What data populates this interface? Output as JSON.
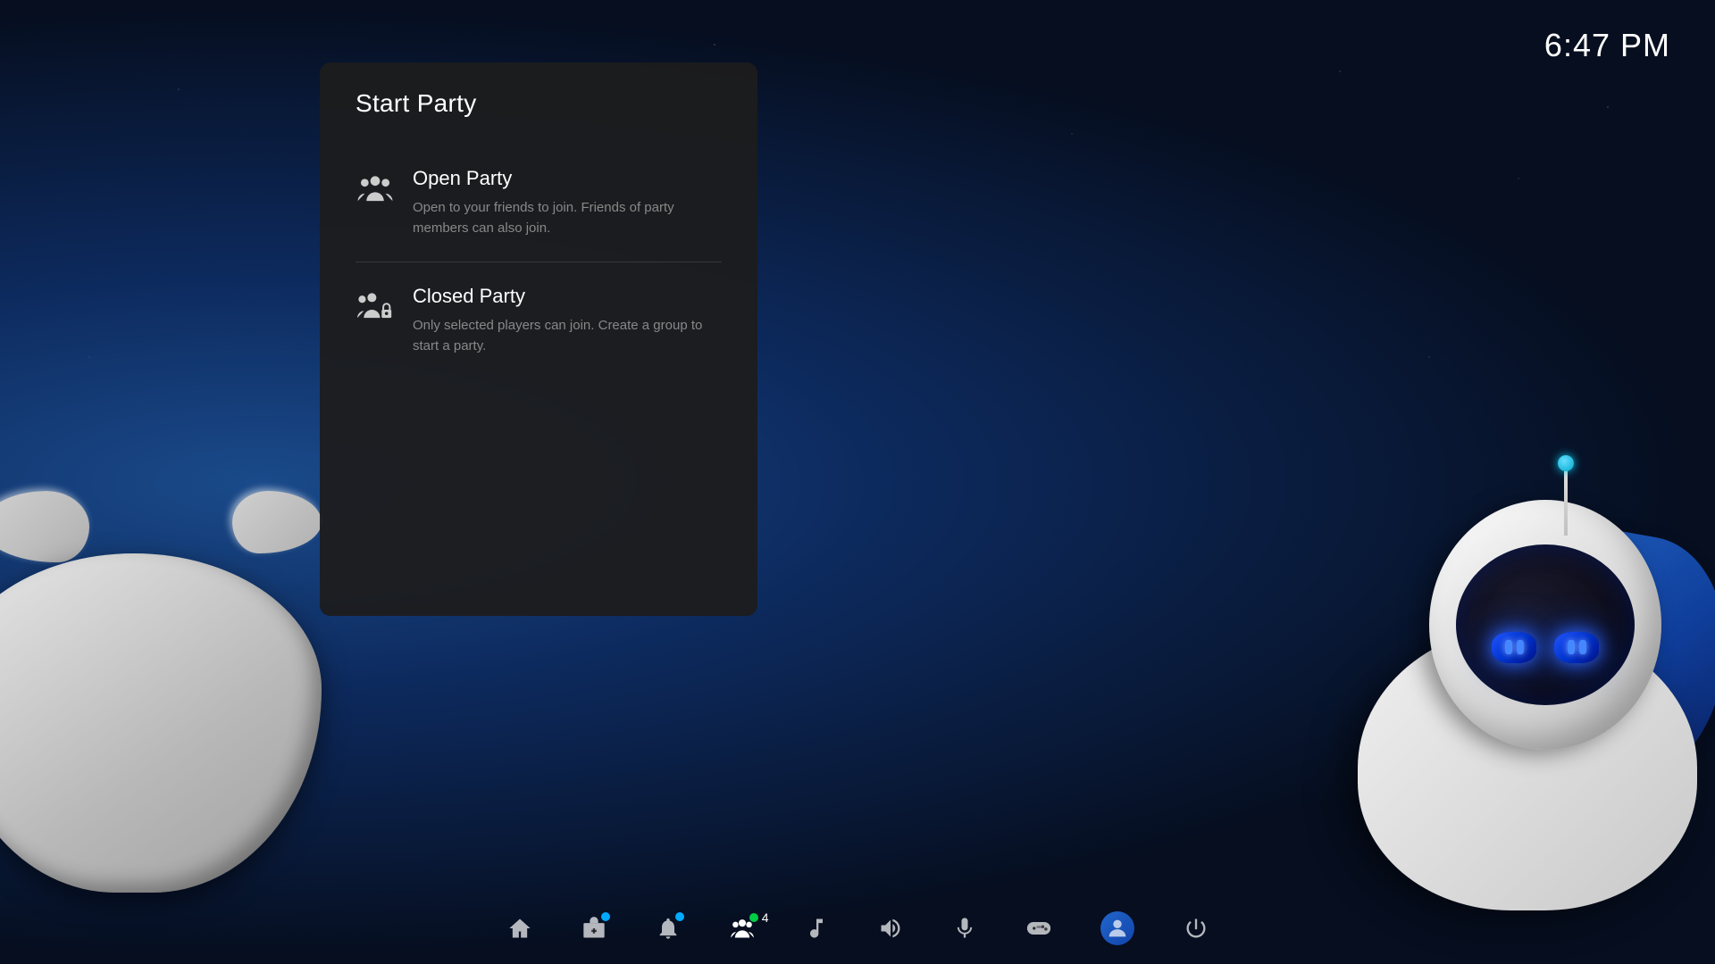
{
  "time": "6:47 PM",
  "modal": {
    "title": "Start Party",
    "options": [
      {
        "id": "open-party",
        "title": "Open Party",
        "description": "Open to your friends to join. Friends of party members can also join.",
        "icon": "open-party-icon"
      },
      {
        "id": "closed-party",
        "title": "Closed Party",
        "description": "Only selected players can join. Create a group to start a party.",
        "icon": "closed-party-icon"
      }
    ]
  },
  "taskbar": {
    "items": [
      {
        "id": "home",
        "label": "Home",
        "icon": "home-icon",
        "active": false
      },
      {
        "id": "store",
        "label": "Store",
        "icon": "store-icon",
        "active": false,
        "hasNotif": true
      },
      {
        "id": "notifications",
        "label": "Notifications",
        "icon": "bell-icon",
        "active": false,
        "hasNotif": true
      },
      {
        "id": "friends",
        "label": "Friends/Party",
        "icon": "party-icon",
        "active": true,
        "badge": "4"
      },
      {
        "id": "music",
        "label": "Music",
        "icon": "music-icon",
        "active": false
      },
      {
        "id": "volume",
        "label": "Volume",
        "icon": "volume-icon",
        "active": false
      },
      {
        "id": "mic",
        "label": "Microphone",
        "icon": "mic-icon",
        "active": false
      },
      {
        "id": "gamepad",
        "label": "Gamepad",
        "icon": "gamepad-icon",
        "active": false
      },
      {
        "id": "profile",
        "label": "Profile",
        "icon": "profile-icon",
        "active": false
      },
      {
        "id": "power",
        "label": "Power",
        "icon": "power-icon",
        "active": false
      }
    ]
  }
}
